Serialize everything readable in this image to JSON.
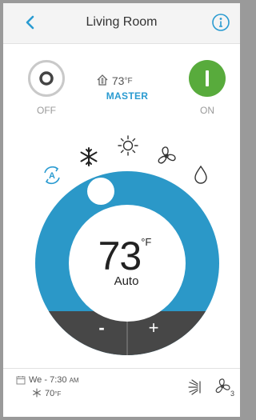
{
  "header": {
    "title": "Living Room"
  },
  "power": {
    "off_label": "OFF",
    "on_label": "ON"
  },
  "master": {
    "temp": "73",
    "unit": "°F",
    "label": "MASTER"
  },
  "modes": [
    "auto",
    "cool",
    "heat",
    "fan",
    "dry"
  ],
  "dial": {
    "temp": "73",
    "unit": "°F",
    "mode": "Auto",
    "minus": "-",
    "plus": "+"
  },
  "footer": {
    "schedule": "We - 7:30",
    "ampm": "AM",
    "sched_temp": "70",
    "sched_unit": "°F",
    "fan_speed": "3"
  },
  "colors": {
    "accent": "#2a9bd1",
    "dial": "#2b98c8",
    "on": "#58ab3c",
    "dark": "#444444"
  }
}
